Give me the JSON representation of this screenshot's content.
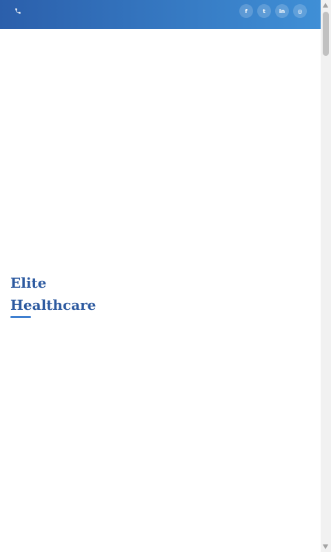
{
  "topbar": {
    "phone_icon": "phone-icon",
    "social": [
      {
        "icon": "facebook-icon",
        "glyph": "f"
      },
      {
        "icon": "twitter-icon",
        "glyph": "t"
      },
      {
        "icon": "linkedin-icon",
        "glyph": "in"
      },
      {
        "icon": "instagram-icon",
        "glyph": "◎"
      }
    ],
    "gradient_start": "#2b5fab",
    "gradient_end": "#3f8fd6"
  },
  "brand": {
    "line1": "Elite",
    "line2": "Healthcare",
    "color": "#2d5aa0",
    "underline_color": "#3f7fd0"
  }
}
